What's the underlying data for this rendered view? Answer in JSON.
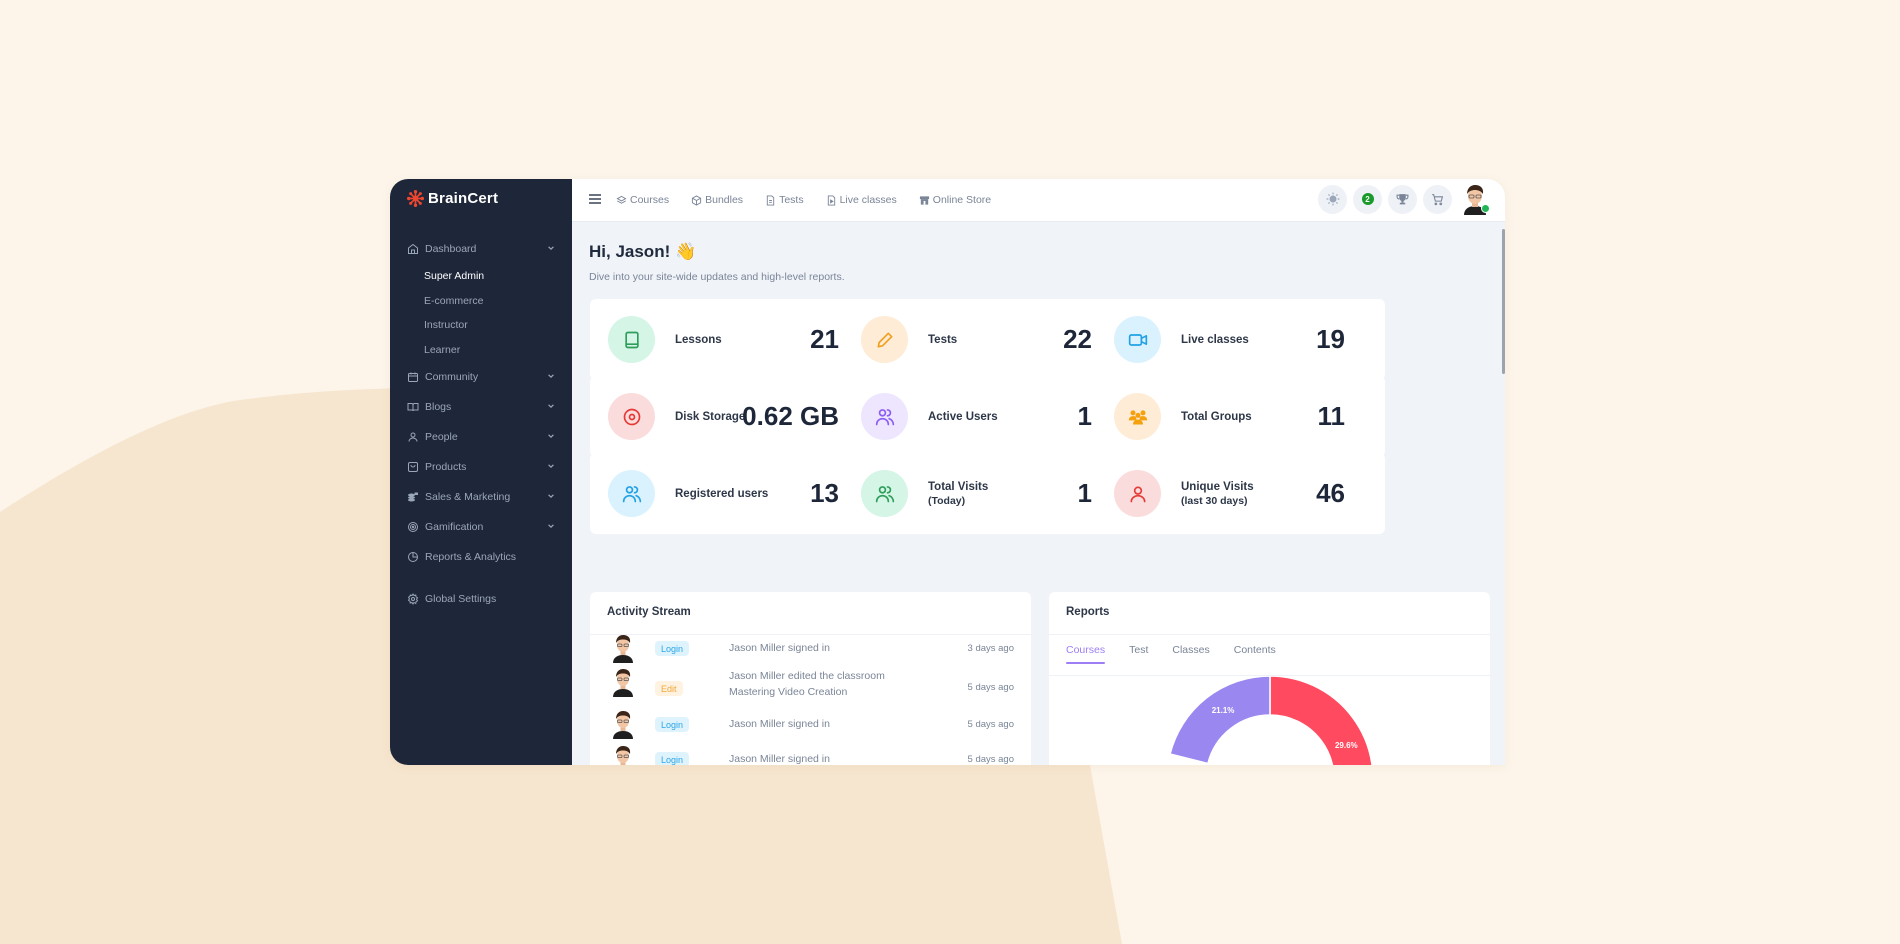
{
  "brand": {
    "name": "BrainCert",
    "logo_color": "#f0462f"
  },
  "sidebar": {
    "items": [
      {
        "label": "Dashboard",
        "icon": "home-icon",
        "expandable": true,
        "children": [
          {
            "label": "Super Admin",
            "active": true
          },
          {
            "label": "E-commerce"
          },
          {
            "label": "Instructor"
          },
          {
            "label": "Learner"
          }
        ]
      },
      {
        "label": "Community",
        "icon": "calendar-icon",
        "expandable": true
      },
      {
        "label": "Blogs",
        "icon": "book-open-icon",
        "expandable": true
      },
      {
        "label": "People",
        "icon": "user-icon",
        "expandable": true
      },
      {
        "label": "Products",
        "icon": "shopping-bag-icon",
        "expandable": true
      },
      {
        "label": "Sales & Marketing",
        "icon": "coins-icon",
        "expandable": true
      },
      {
        "label": "Gamification",
        "icon": "target-icon",
        "expandable": true
      },
      {
        "label": "Reports & Analytics",
        "icon": "pie-chart-icon",
        "expandable": false
      },
      {
        "label": "Global Settings",
        "icon": "gear-icon",
        "expandable": false
      }
    ]
  },
  "topbar": {
    "nav": [
      {
        "label": "Courses",
        "icon": "layers-icon"
      },
      {
        "label": "Bundles",
        "icon": "box-icon"
      },
      {
        "label": "Tests",
        "icon": "file-icon"
      },
      {
        "label": "Live classes",
        "icon": "file-video-icon"
      },
      {
        "label": "Online Store",
        "icon": "store-icon"
      }
    ],
    "notification_count": "2",
    "user_status_color": "#22b455"
  },
  "main": {
    "greeting": "Hi, Jason! 👋",
    "subtitle": "Dive into your site-wide updates and high-level reports.",
    "stats": [
      {
        "label": "Lessons",
        "sub": "",
        "value": "21",
        "icon": "book-icon",
        "color": "#2f9e5b",
        "bg": "#d5f5e6"
      },
      {
        "label": "Tests",
        "sub": "",
        "value": "22",
        "icon": "pencil-icon",
        "color": "#f0a020",
        "bg": "#feecd6"
      },
      {
        "label": "Live classes",
        "sub": "",
        "value": "19",
        "icon": "video-icon",
        "color": "#22a1e6",
        "bg": "#daf2fd"
      },
      {
        "label": "Disk Storage",
        "sub": "",
        "value": "0.62 GB",
        "icon": "disc-icon",
        "color": "#e53935",
        "bg": "#fbdcdc"
      },
      {
        "label": "Active Users",
        "sub": "",
        "value": "1",
        "icon": "users-icon",
        "color": "#8b5cf6",
        "bg": "#ede6fe"
      },
      {
        "label": "Total Groups",
        "sub": "",
        "value": "11",
        "icon": "group-icon",
        "color": "#f5a00f",
        "bg": "#feecd6"
      },
      {
        "label": "Registered users",
        "sub": "",
        "value": "13",
        "icon": "users-icon",
        "color": "#22a1e6",
        "bg": "#daf2fd"
      },
      {
        "label": "Total Visits",
        "sub": "(Today)",
        "value": "1",
        "icon": "users-icon",
        "color": "#2f9e5b",
        "bg": "#d5f5e6"
      },
      {
        "label": "Unique Visits",
        "sub": "(last 30 days)",
        "value": "46",
        "icon": "user-icon",
        "color": "#e53935",
        "bg": "#fbdcdc"
      }
    ],
    "activity": {
      "title": "Activity Stream",
      "rows": [
        {
          "badge": "Login",
          "type": "login",
          "text": "Jason Miller signed in",
          "time": "3 days ago"
        },
        {
          "badge": "Edit",
          "type": "edit",
          "text": "Jason Miller edited the classroom Mastering Video Creation",
          "time": "5 days ago"
        },
        {
          "badge": "Login",
          "type": "login",
          "text": "Jason Miller signed in",
          "time": "5 days ago"
        },
        {
          "badge": "Login",
          "type": "login",
          "text": "Jason Miller signed in",
          "time": "5 days ago"
        }
      ]
    },
    "reports": {
      "title": "Reports",
      "tabs": [
        {
          "label": "Courses",
          "active": true
        },
        {
          "label": "Test"
        },
        {
          "label": "Classes"
        },
        {
          "label": "Contents"
        }
      ]
    }
  },
  "chart_data": {
    "type": "pie",
    "variant": "donut",
    "title": "Courses",
    "slices_visible": [
      {
        "label": "29.6%",
        "value": 29.6,
        "color": "#ff4a5f"
      },
      {
        "label": "21.1%",
        "value": 21.1,
        "color": "#9b87f0"
      }
    ],
    "note": "chart is partially cropped; only the top of the donut is visible, starting at 12 o'clock"
  }
}
